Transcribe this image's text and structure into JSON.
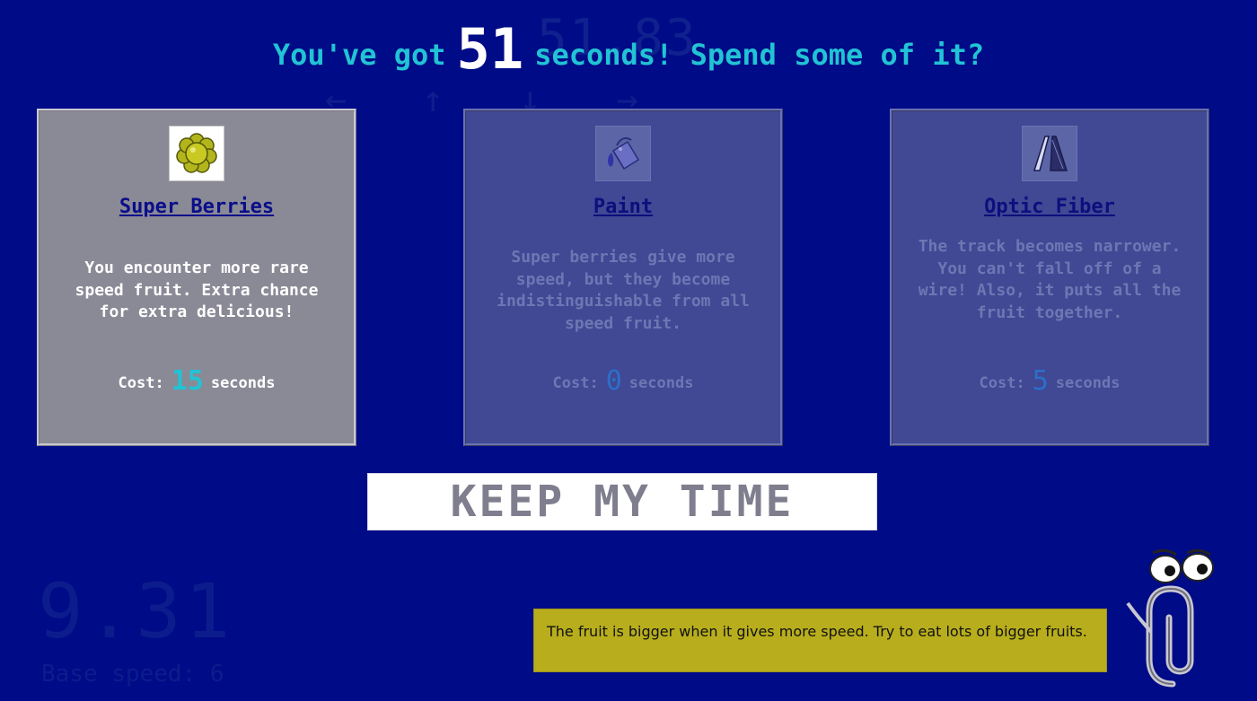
{
  "background_hud": {
    "time": "51.83",
    "glyphs": "← ↑ ↓ →",
    "speed": "9.31",
    "base_speed": "Base speed: 6"
  },
  "header": {
    "prefix": "You've got",
    "seconds": "51",
    "suffix": "seconds! Spend some of it?"
  },
  "cards": [
    {
      "icon": "berry-icon",
      "title": "Super Berries",
      "description": "You encounter more rare speed fruit. Extra chance for extra delicious!",
      "cost_label": "Cost:",
      "cost_value": "15",
      "cost_unit": "seconds",
      "state": "selected"
    },
    {
      "icon": "paint-bucket-icon",
      "title": "Paint",
      "description": "Super berries give more speed, but they become indistinguishable from all speed fruit.",
      "cost_label": "Cost:",
      "cost_value": "0",
      "cost_unit": "seconds",
      "state": "dim"
    },
    {
      "icon": "optic-fiber-icon",
      "title": "Optic Fiber",
      "description": "The track becomes narrower. You can't fall off of a wire! Also, it puts all the fruit together.",
      "cost_label": "Cost:",
      "cost_value": "5",
      "cost_unit": "seconds",
      "state": "dim"
    }
  ],
  "keep_button": {
    "label": "KEEP MY TIME"
  },
  "tip": {
    "text": "The fruit is bigger when it gives more speed. Try to eat lots of bigger fruits."
  },
  "colors": {
    "background": "#000b87",
    "accent": "#21c3d4",
    "tip_background": "#b8ae1d"
  }
}
